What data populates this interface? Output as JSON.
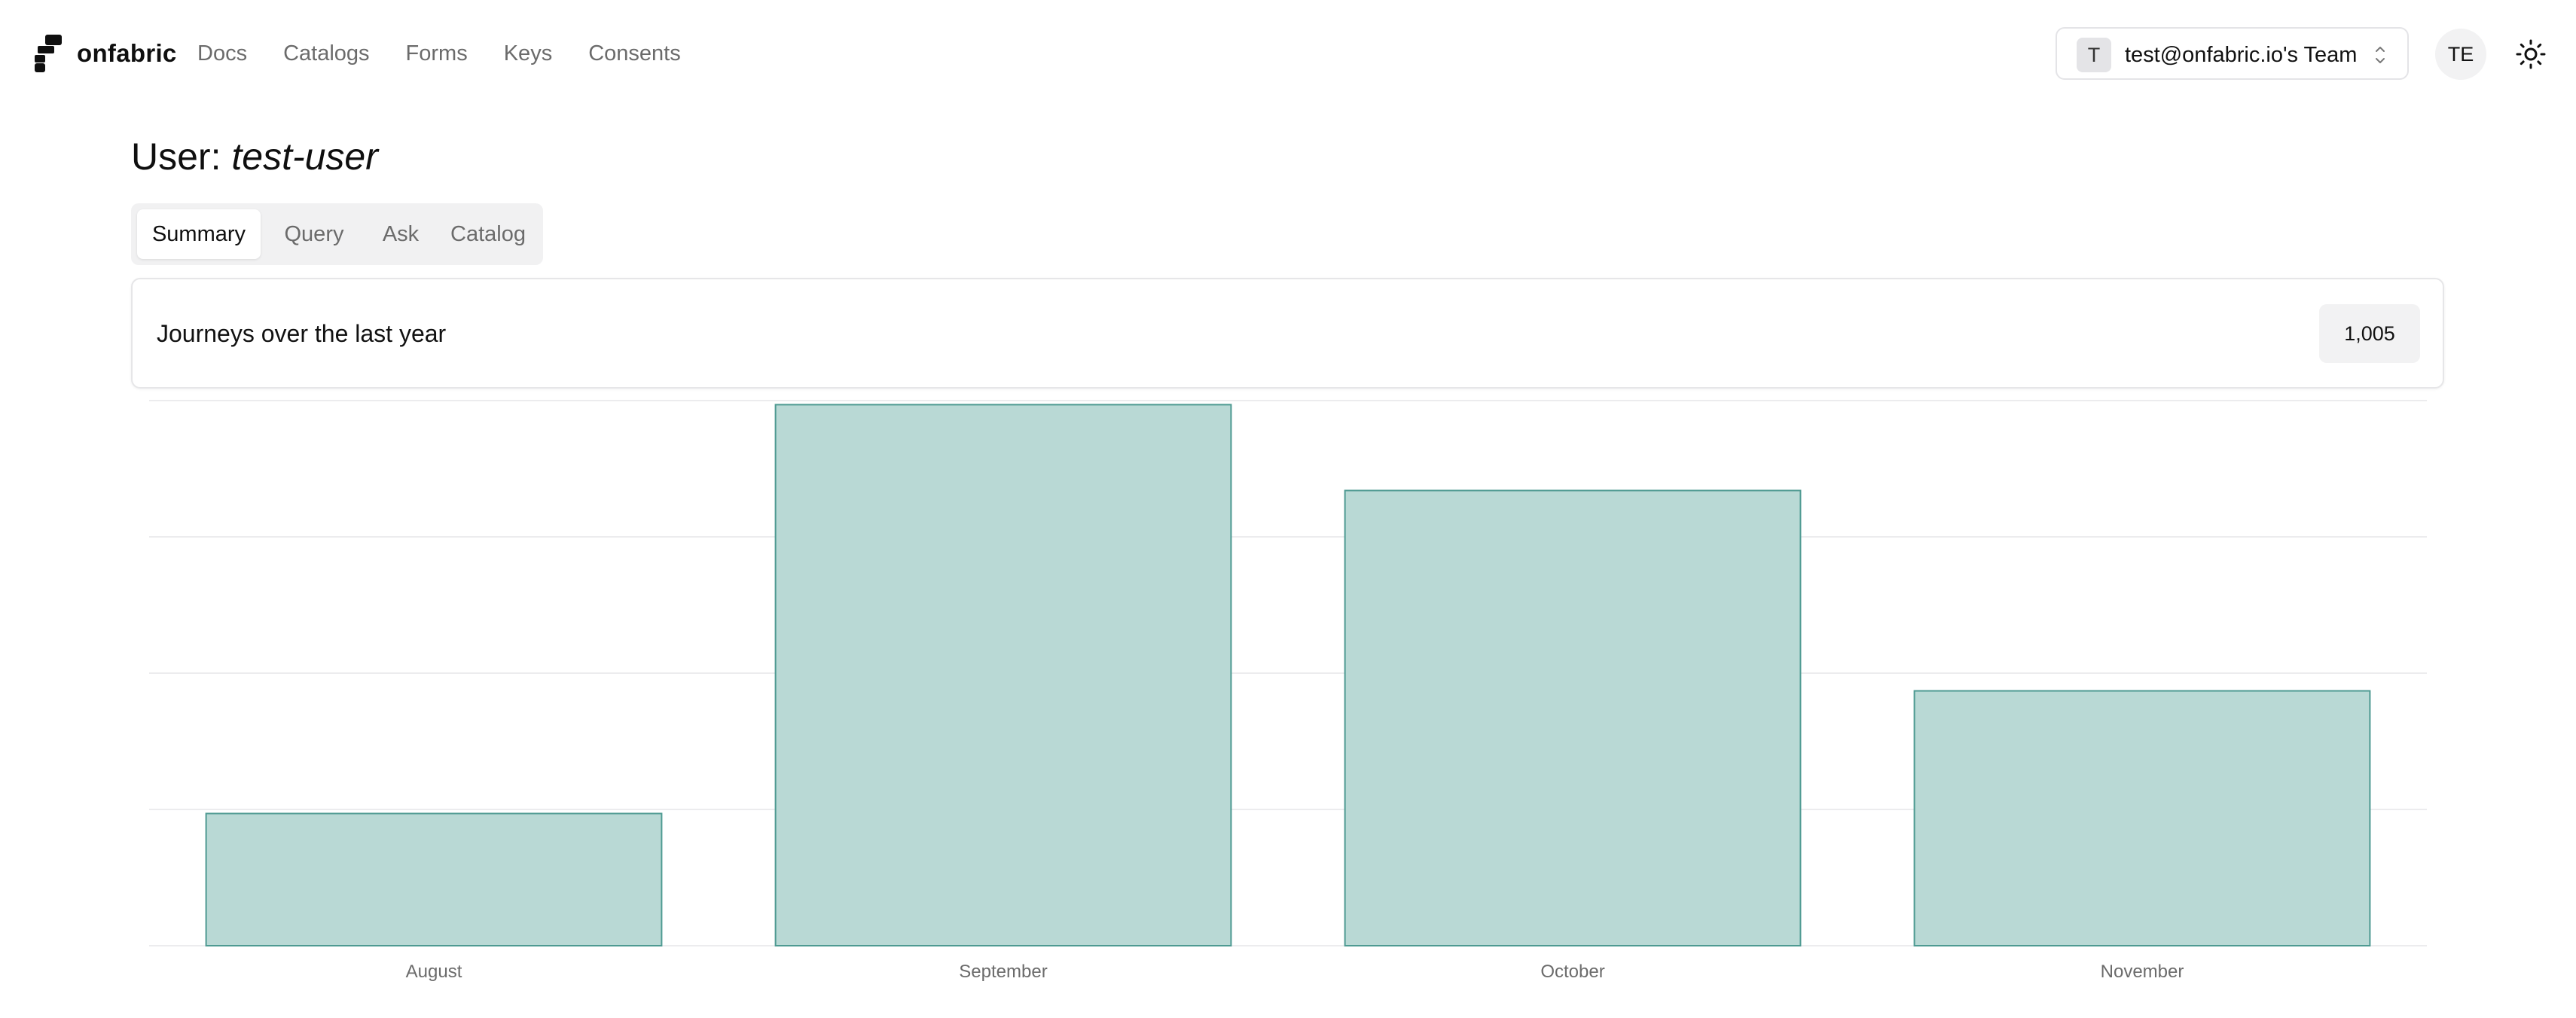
{
  "nav": {
    "brand": "onfabric",
    "links": [
      "Docs",
      "Catalogs",
      "Forms",
      "Keys",
      "Consents"
    ],
    "team_badge": "T",
    "team_label": "test@onfabric.io's Team",
    "avatar_initials": "TE"
  },
  "page": {
    "title_prefix": "User:",
    "username": "test-user"
  },
  "tabs": [
    {
      "label": "Summary",
      "active": true
    },
    {
      "label": "Query",
      "active": false
    },
    {
      "label": "Ask",
      "active": false
    },
    {
      "label": "Catalog",
      "active": false
    }
  ],
  "summary_card": {
    "title": "Journeys over the last year",
    "count": "1,005"
  },
  "colors": {
    "bar_fill": "#b9d9d5",
    "bar_stroke": "#4e9a92",
    "grid": "#ececee",
    "axis_text": "#6b6b6b"
  },
  "chart_data": {
    "type": "bar",
    "categories": [
      "August",
      "September",
      "October",
      "November"
    ],
    "values": [
      97,
      397,
      334,
      187
    ],
    "ylim": [
      0,
      400
    ],
    "grid": true,
    "grid_lines": 5
  }
}
